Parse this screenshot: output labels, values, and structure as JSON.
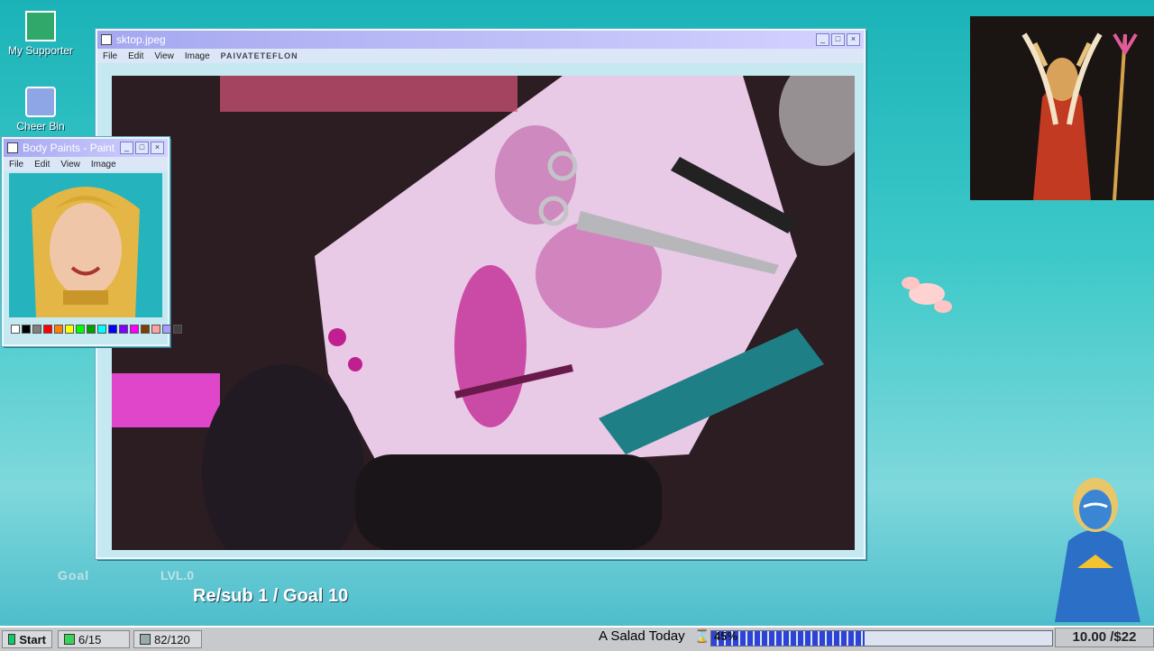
{
  "desktop_icons": [
    {
      "label": "My Supporter",
      "icon": "monitor-user-icon"
    },
    {
      "label": "Cheer Bin",
      "icon": "bin-icon"
    }
  ],
  "main_window": {
    "title": "sktop.jpeg",
    "menu": [
      "File",
      "Edit",
      "View",
      "Image"
    ],
    "overlay_name": "PAIVATETEFLON",
    "buttons": [
      "_",
      "□",
      "×"
    ]
  },
  "paint_window": {
    "title": "Body Paints - Paint",
    "menu": [
      "File",
      "Edit",
      "View",
      "Image"
    ],
    "palette": [
      "#ffffff",
      "#000000",
      "#7f7f7f",
      "#ff0000",
      "#ff7f00",
      "#ffff00",
      "#00ff00",
      "#00a000",
      "#00ffff",
      "#0000ff",
      "#7f00ff",
      "#ff00ff",
      "#804000",
      "#ffa0a0",
      "#a0a0ff",
      "#404040"
    ]
  },
  "goal": {
    "label": "Goal",
    "level": "LVL.0",
    "text": "Re/sub 1 / Goal 10"
  },
  "taskbar": {
    "start": "Start",
    "follow_count": "6/15",
    "sub_count": "82/120",
    "salad_label": "A Salad Today",
    "progress": 45,
    "progress_label": "45%",
    "money": "10.00 /$22"
  },
  "colors": {
    "desktop": "#1bb3b8",
    "titlebar": "#a5a8f0",
    "progress": "#2c43d9"
  }
}
